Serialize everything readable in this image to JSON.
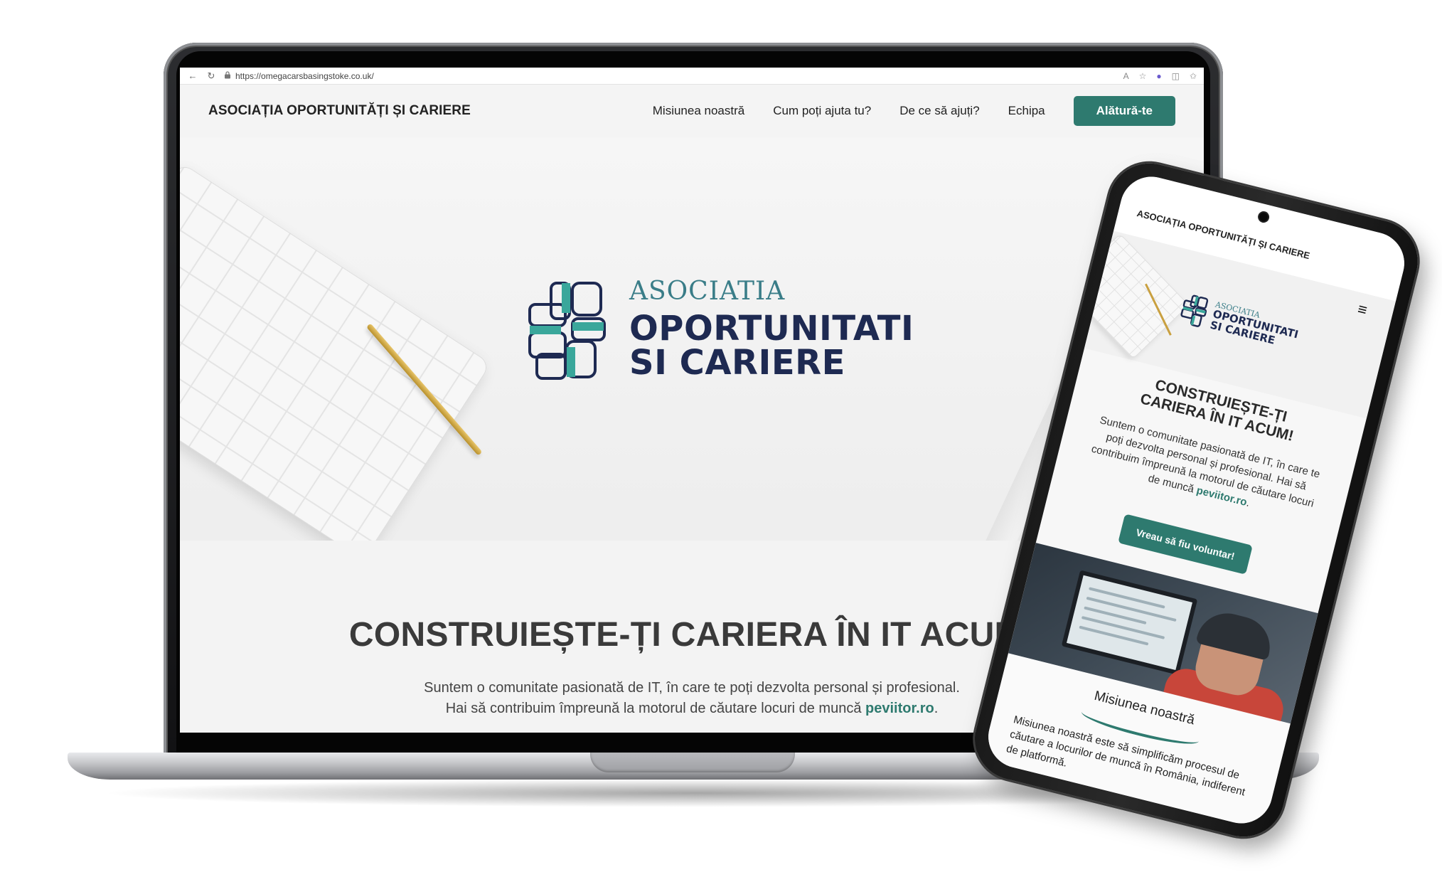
{
  "browser": {
    "url": "https://omegacarsbasingstoke.co.uk/"
  },
  "site": {
    "brand": "ASOCIAȚIA OPORTUNITĂȚI ȘI CARIERE",
    "nav": [
      "Misiunea noastră",
      "Cum poți ajuta tu?",
      "De ce să ajuți?",
      "Echipa"
    ],
    "cta": "Alătură-te",
    "logo": {
      "small": "ASOCIATIA",
      "line1": "OPORTUNITATI",
      "line2": "SI CARIERE"
    },
    "hero_title": "CONSTRUIEȘTE-ȚI CARIERA ÎN IT ACUM!",
    "hero_sub_line1": "Suntem o comunitate pasionată de IT, în care te poți dezvolta personal și profesional.",
    "hero_sub_line2_prefix": "Hai să contribuim împreună la motorul de căutare locuri de muncă ",
    "hero_sub_link": "peviitor.ro",
    "hero_sub_line2_suffix": "."
  },
  "mobile": {
    "brand": "ASOCIAȚIA OPORTUNITĂȚI ȘI CARIERE",
    "menu_icon": "≡",
    "logo": {
      "small": "ASOCIATIA",
      "line1": "OPORTUNITATI",
      "line2": "SI CARIERE"
    },
    "title_line1": "CONSTRUIEȘTE-ȚI",
    "title_line2": "CARIERA ÎN IT ACUM!",
    "text": "Suntem o comunitate pasionată de IT, în care te poți dezvolta personal și profesional. Hai să contribuim împreună la motorul de căutare locuri de muncă ",
    "text_link": "peviitor.ro",
    "text_suffix": ".",
    "button": "Vreau să fiu voluntar!",
    "section_title": "Misiunea noastră",
    "section_text": "Misiunea noastră este să simplificăm procesul de căutare a locurilor de muncă în România, indiferent de platformă."
  },
  "colors": {
    "accent": "#2e7a6f",
    "logo_navy": "#1e2a52",
    "logo_teal": "#3a7d88"
  }
}
